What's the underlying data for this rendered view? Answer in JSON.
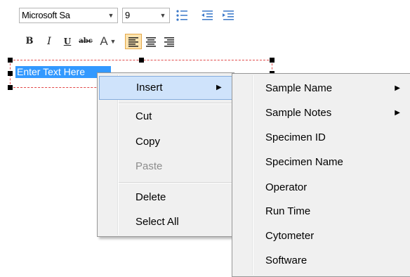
{
  "toolbar": {
    "font_name": "Microsoft Sa",
    "font_size": "9",
    "bold_label": "B",
    "italic_label": "I",
    "underline_label": "U",
    "strike_label": "abc",
    "font_color_label": "A",
    "icons": [
      "bullet-list-icon",
      "decrease-indent-icon",
      "increase-indent-icon",
      "align-left-icon",
      "align-center-icon",
      "align-right-icon"
    ],
    "active_alignment": "left",
    "active_color": "#fde4b0"
  },
  "textbox": {
    "text": "Enter Text Here",
    "selection_color": "#3399ff",
    "border_color": "#e24a4a"
  },
  "context_menu": {
    "items": [
      {
        "label": "Insert",
        "submenu": true,
        "highlighted": true
      },
      {
        "label": "Cut"
      },
      {
        "label": "Copy"
      },
      {
        "label": "Paste",
        "disabled": true
      },
      {
        "label": "Delete"
      },
      {
        "label": "Select All"
      }
    ]
  },
  "insert_submenu": {
    "items": [
      {
        "label": "Sample Name",
        "submenu": true
      },
      {
        "label": "Sample Notes",
        "submenu": true
      },
      {
        "label": "Specimen ID"
      },
      {
        "label": "Specimen Name"
      },
      {
        "label": "Operator"
      },
      {
        "label": "Run Time"
      },
      {
        "label": "Cytometer"
      },
      {
        "label": "Software"
      }
    ]
  }
}
